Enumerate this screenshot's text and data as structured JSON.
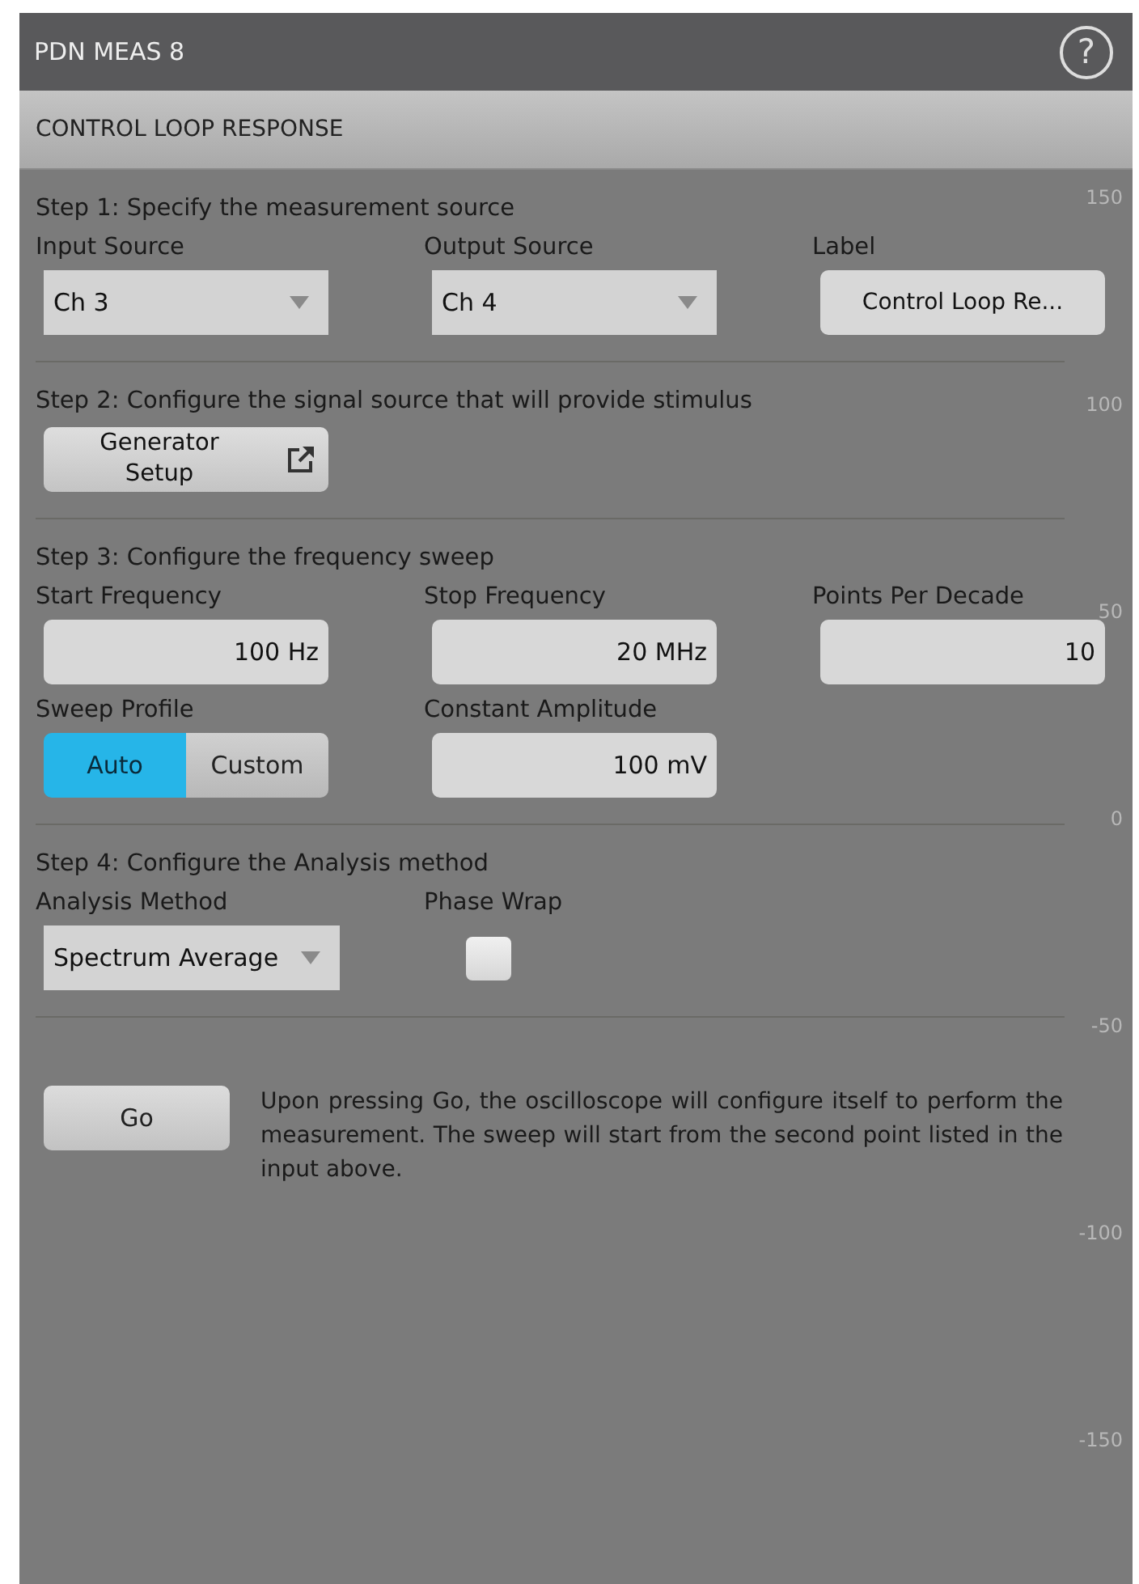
{
  "window": {
    "title": "PDN MEAS 8",
    "help": "?"
  },
  "header": "CONTROL LOOP RESPONSE",
  "axis_labels": [
    "150",
    "100",
    "50",
    "0",
    "-50",
    "-100",
    "-150"
  ],
  "steps": [
    {
      "title": "Step 1: Specify the measurement source",
      "controls": [
        {
          "kind": "dropdown",
          "label": "Input Source",
          "value": "Ch 3"
        },
        {
          "kind": "dropdown",
          "label": "Output Source",
          "value": "Ch 4"
        },
        {
          "kind": "textbutton",
          "label": "Label",
          "value": "Control Loop Re..."
        }
      ]
    },
    {
      "title": "Step 2: Configure the signal source that will provide stimulus",
      "controls": [
        {
          "kind": "linkbutton",
          "value": "Generator Setup"
        }
      ]
    },
    {
      "title": "Step 3: Configure the frequency sweep",
      "controls": [
        {
          "kind": "field",
          "label": "Start Frequency",
          "value": "100 Hz"
        },
        {
          "kind": "field",
          "label": "Stop Frequency",
          "value": "20 MHz"
        },
        {
          "kind": "field",
          "label": "Points Per Decade",
          "value": "10"
        },
        {
          "kind": "segmented",
          "label": "Sweep Profile",
          "options": [
            {
              "text": "Auto",
              "selected": true
            },
            {
              "text": "Custom",
              "selected": false
            }
          ]
        },
        {
          "kind": "field",
          "label": "Constant Amplitude",
          "value": "100 mV"
        }
      ]
    },
    {
      "title": "Step 4: Configure the Analysis method",
      "controls": [
        {
          "kind": "dropdown",
          "label": "Analysis Method",
          "value": "Spectrum Average"
        },
        {
          "kind": "checkbox",
          "label": "Phase Wrap",
          "checked": false
        }
      ]
    }
  ],
  "go": {
    "button": "Go",
    "note": "Upon pressing Go, the oscilloscope will configure itself to perform the measurement. The sweep will start from the second point listed in the input above."
  }
}
